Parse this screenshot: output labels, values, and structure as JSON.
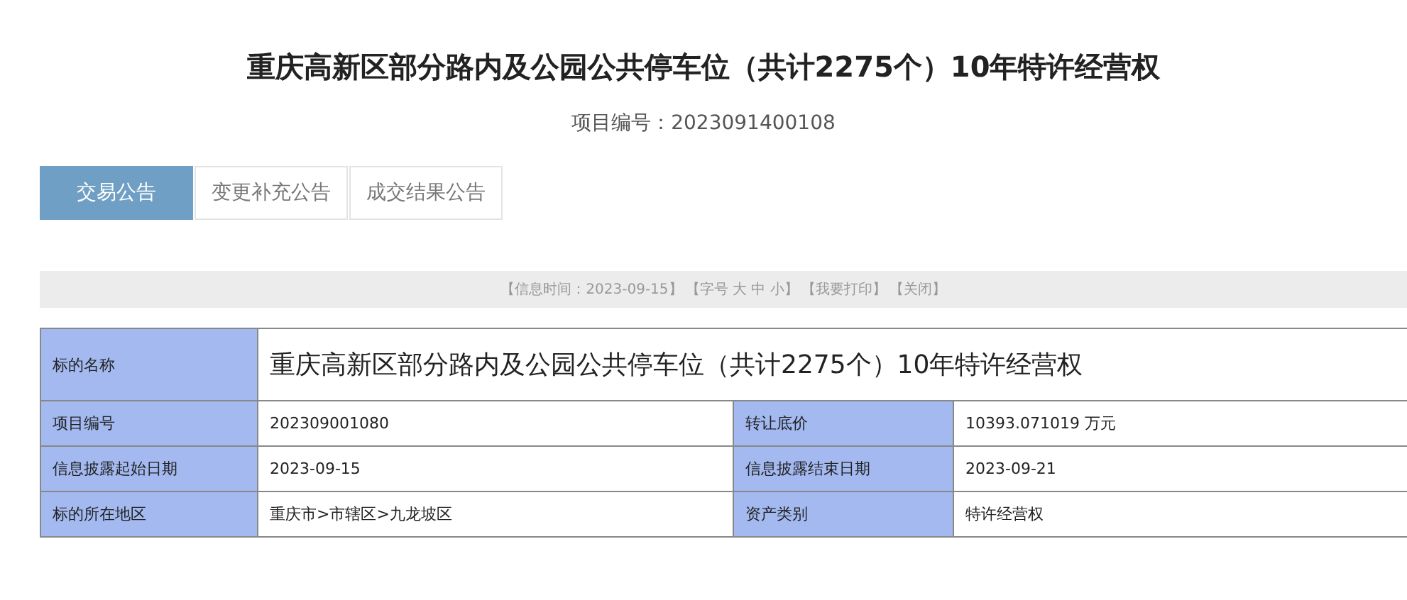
{
  "title": "重庆高新区部分路内及公园公共停车位（共计2275个）10年特许经营权",
  "project_number": {
    "label": "项目编号：",
    "value": "2023091400108"
  },
  "tabs": [
    {
      "label": "交易公告",
      "selected": true
    },
    {
      "label": "变更补充公告",
      "selected": false
    },
    {
      "label": "成交结果公告",
      "selected": false
    }
  ],
  "info_bar": [
    "【信息时间：2023-09-15】",
    "【字号 大 中 小】",
    "【我要打印】",
    "【关闭】"
  ],
  "table": {
    "name_row": {
      "label": "标的名称",
      "value": "重庆高新区部分路内及公园公共停车位（共计2275个）10年特许经营权"
    },
    "rows": [
      {
        "label_1": "项目编号",
        "value_1": "202309001080",
        "label_2": "转让底价",
        "value_2": "10393.071019 万元"
      },
      {
        "label_1": "信息披露起始日期",
        "value_1": "2023-09-15",
        "label_2": "信息披露结束日期",
        "value_2": "2023-09-21"
      },
      {
        "label_1": "标的所在地区",
        "value_1": "重庆市>市辖区>九龙坡区",
        "label_2": "资产类别",
        "value_2": "特许经营权"
      }
    ]
  }
}
